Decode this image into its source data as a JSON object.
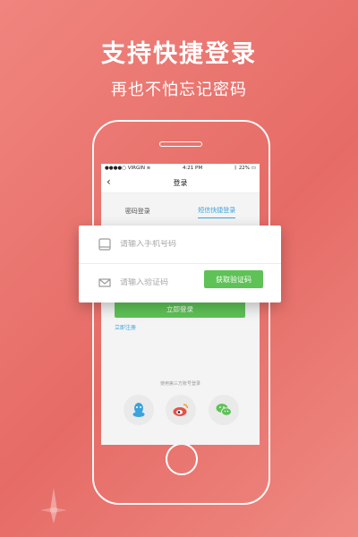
{
  "promo": {
    "headline": "支持快捷登录",
    "subheadline": "再也不怕忘记密码"
  },
  "status_bar": {
    "carrier": "VIRGIN",
    "time": "4:21 PM",
    "battery": "22%"
  },
  "nav": {
    "title": "登录"
  },
  "tabs": [
    {
      "label": "密码登录",
      "active": false
    },
    {
      "label": "短信快捷登录",
      "active": true
    }
  ],
  "form": {
    "phone_placeholder": "请输入手机号码",
    "code_placeholder": "请输入验证码",
    "get_code_label": "获取验证码"
  },
  "actions": {
    "login_label": "立即登录",
    "register_label": "立即注册"
  },
  "third_party": {
    "label": "使用第三方账号登录",
    "icons": [
      "qq-icon",
      "weibo-icon",
      "wechat-icon"
    ]
  },
  "colors": {
    "accent_green": "#5ec256",
    "accent_blue": "#3aa3dc",
    "background": "#e66b66"
  }
}
